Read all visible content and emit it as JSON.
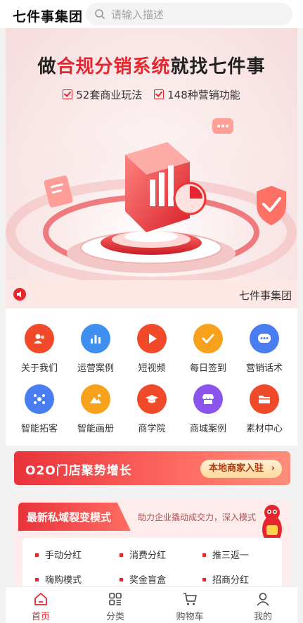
{
  "header": {
    "title": "七件事集团",
    "search_placeholder": "请输入描述",
    "search_icon": "search-icon"
  },
  "banner": {
    "headline_pre": "做",
    "headline_highlight": "合规分销系统",
    "headline_post": "就找七件事",
    "features": [
      "52套商业玩法",
      "148种营销功能"
    ],
    "accent": "#e5262f"
  },
  "notice": {
    "icon": "speaker-icon",
    "text": "七件事集团"
  },
  "grid": {
    "items": [
      {
        "label": "关于我们",
        "icon": "people-icon",
        "color": "#f04a2a"
      },
      {
        "label": "运营案例",
        "icon": "bar-chart-icon",
        "color": "#3f8ff0"
      },
      {
        "label": "短视频",
        "icon": "play-icon",
        "color": "#f04a2a"
      },
      {
        "label": "每日签到",
        "icon": "checkmark-icon",
        "color": "#f7a11c"
      },
      {
        "label": "营销话术",
        "icon": "chat-bubble-icon",
        "color": "#4a7ef0"
      },
      {
        "label": "智能拓客",
        "icon": "network-icon",
        "color": "#4a7ef0"
      },
      {
        "label": "智能画册",
        "icon": "picture-icon",
        "color": "#f7a11c"
      },
      {
        "label": "商学院",
        "icon": "graduation-cap-icon",
        "color": "#f04a2a"
      },
      {
        "label": "商城案例",
        "icon": "shop-icon",
        "color": "#8b54ea"
      },
      {
        "label": "素材中心",
        "icon": "folder-icon",
        "color": "#f04a2a"
      }
    ]
  },
  "store": {
    "title": "O2O门店聚势增长",
    "button": "本地商家入驻",
    "button_arrow": "chevron-right-icon"
  },
  "private_domain": {
    "title": "最新私域裂变模式",
    "subtitle": "助力企业撬动成交力，深入模式",
    "tags": [
      "手动分红",
      "消费分红",
      "推三返一",
      "嗨购模式",
      "奖金盲盒",
      "招商分红"
    ]
  },
  "tabbar": {
    "items": [
      {
        "label": "首页",
        "icon": "home-icon",
        "active": true
      },
      {
        "label": "分类",
        "icon": "category-grid-icon",
        "active": false
      },
      {
        "label": "购物车",
        "icon": "cart-icon",
        "active": false
      },
      {
        "label": "我的",
        "icon": "user-icon",
        "active": false
      }
    ]
  }
}
